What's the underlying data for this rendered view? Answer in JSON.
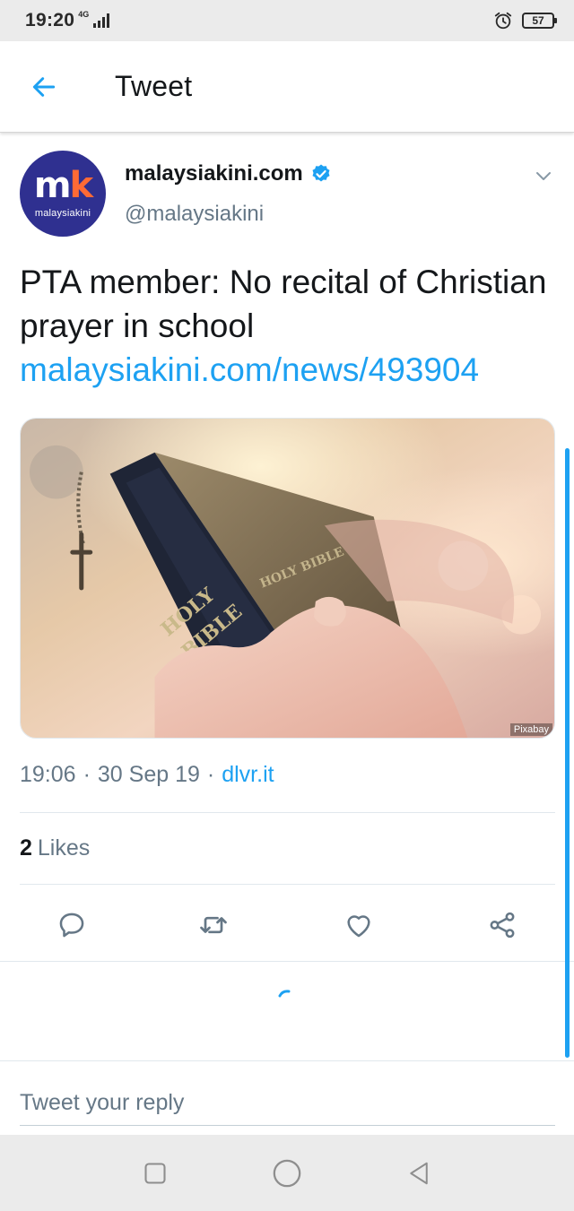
{
  "status_bar": {
    "time": "19:20",
    "network": "4G",
    "battery": "57"
  },
  "header": {
    "back_icon": "arrow-left-icon",
    "title": "Tweet"
  },
  "tweet": {
    "avatar": {
      "mark": "mk",
      "word": "malaysiakini",
      "bg_color": "#2f3090",
      "accent_color": "#ff6a35"
    },
    "author_name": "malaysiakini.com",
    "verified_icon": "verified-badge-icon",
    "handle": "@malaysiakini",
    "menu_icon": "chevron-down-icon",
    "text": "PTA member: No recital of Christian prayer in school",
    "link": "malaysiakini.com/news/493904",
    "media": {
      "book_spine_text_1": "HOLY",
      "book_spine_text_2": "BIBLE",
      "book_top_text": "HOLY BIBLE",
      "credit": "Pixabay"
    },
    "time": "19:06",
    "date": "30 Sep 19",
    "source": "dlvr.it",
    "likes_count": "2",
    "likes_label": "Likes"
  },
  "actions": [
    {
      "icon": "reply-icon"
    },
    {
      "icon": "retweet-icon"
    },
    {
      "icon": "like-heart-icon"
    },
    {
      "icon": "share-icon"
    }
  ],
  "reply": {
    "placeholder": "Tweet your reply"
  },
  "nav_bar": {
    "icons": [
      "recent-apps-icon",
      "home-icon",
      "back-icon"
    ]
  },
  "colors": {
    "twitter_blue": "#1da1f2",
    "text_primary": "#14171a",
    "text_secondary": "#657786",
    "divider": "#e1e8ed"
  }
}
